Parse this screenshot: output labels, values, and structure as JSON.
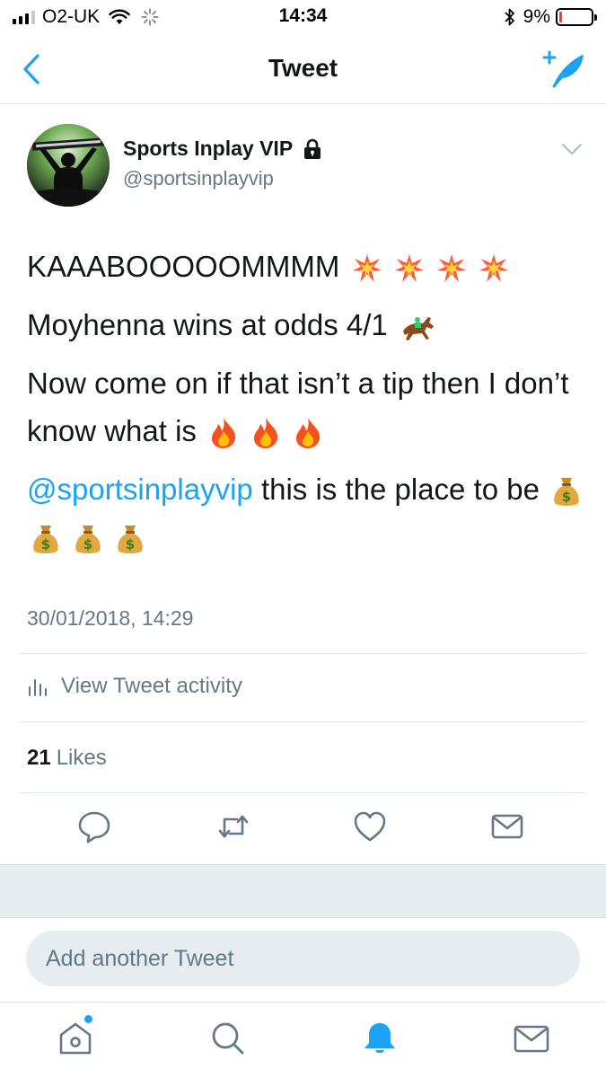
{
  "status_bar": {
    "carrier": "O2-UK",
    "time": "14:34",
    "battery_percent": "9%",
    "battery_level": 0.09,
    "battery_color": "#ff3b30"
  },
  "nav": {
    "title": "Tweet",
    "back_icon": "chevron-left-icon",
    "compose_icon": "compose-tweet-icon"
  },
  "tweet": {
    "display_name": "Sports Inplay VIP",
    "handle": "@sportsinplayvip",
    "lines": {
      "line1": "KAAABOOOOOMMMM",
      "line2": "Moyhenna wins at odds 4/1",
      "line3": "Now come on if that isn’t a tip then I don’t know what is",
      "line4_mention": "@sportsinplayvip",
      "line4_text": " this is the place to be"
    },
    "timestamp": "30/01/2018, 14:29",
    "activity_label": "View Tweet activity",
    "likes_count": "21",
    "likes_label": "Likes"
  },
  "reply": {
    "placeholder": "Add another Tweet"
  },
  "actions": [
    "reply-icon",
    "retweet-icon",
    "like-icon",
    "share-mail-icon"
  ],
  "tabs": [
    "home-icon",
    "search-icon",
    "notifications-icon",
    "messages-icon"
  ],
  "colors": {
    "accent": "#1da1f2",
    "secondary_text": "#657786",
    "divider": "#e1e8ed"
  }
}
